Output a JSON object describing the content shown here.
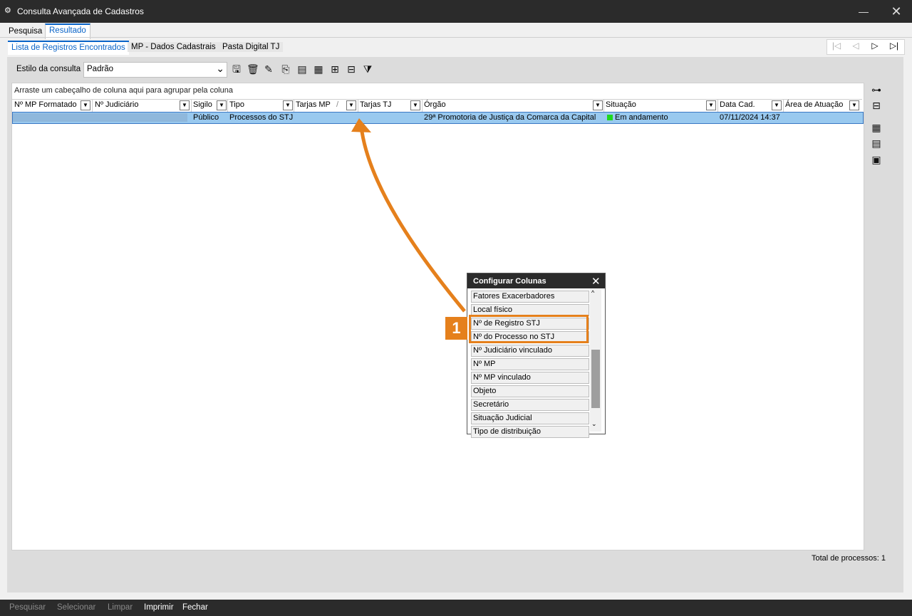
{
  "window": {
    "title": "Consulta Avançada de Cadastros",
    "minimize": "—",
    "close": "✕"
  },
  "main_tabs": [
    {
      "label": "Pesquisa"
    },
    {
      "label": "Resultado"
    }
  ],
  "sub_tabs": [
    {
      "label": "Lista de Registros Encontrados"
    },
    {
      "label": "MP - Dados Cadastrais"
    },
    {
      "label": "Pasta Digital TJ"
    }
  ],
  "record_nav": {
    "first": "|◁",
    "prev": "◁",
    "next": "▷",
    "last": "▷|"
  },
  "toolbar": {
    "estilo_label": "Estilo da consulta",
    "estilo_value": "Padrão",
    "icons": [
      "save-icon",
      "delete-icon",
      "edit-icon",
      "export-icon",
      "document-icon",
      "columns-icon",
      "tree-icon",
      "tree-alt-icon",
      "filter-icon"
    ]
  },
  "grid": {
    "group_hint": "Arraste um cabeçalho de coluna aqui para agrupar pela coluna",
    "columns": [
      "Nº MP Formatado",
      "Nº Judiciário",
      "Sigilo",
      "Tipo",
      "Tarjas MP",
      "Tarjas TJ",
      "Órgão",
      "Situação",
      "Data Cad.",
      "Área de Atuação"
    ],
    "sort_marker": "/",
    "rows": [
      {
        "sigilo": "Público",
        "tipo": "Processos do STJ",
        "orgao": "29ª Promotoria de Justiça da Comarca da Capital",
        "situacao": "Em andamento",
        "situacao_color": "#1ed81e",
        "data": "07/11/2024 14:37"
      }
    ]
  },
  "side_icons": [
    "group-tree-icon",
    "layers-icon",
    "grid-view-icon",
    "list-view-icon",
    "card-view-icon"
  ],
  "total": "Total de processos: 1",
  "footer": {
    "pesquisar": "Pesquisar",
    "selecionar": "Selecionar",
    "limpar": "Limpar",
    "imprimir": "Imprimir",
    "fechar": "Fechar"
  },
  "config_popup": {
    "title": "Configurar Colunas",
    "items": [
      "Fatores Exacerbadores",
      "Local físico",
      "Nº de Registro STJ",
      "Nº do Processo no STJ",
      "Nº Judiciário vinculado",
      "Nº MP",
      "Nº MP vinculado",
      "Objeto",
      "Secretário",
      "Situação Judicial",
      "Tipo de distribuição"
    ]
  },
  "annotation": {
    "badge": "1",
    "accent": "#e5801c"
  }
}
